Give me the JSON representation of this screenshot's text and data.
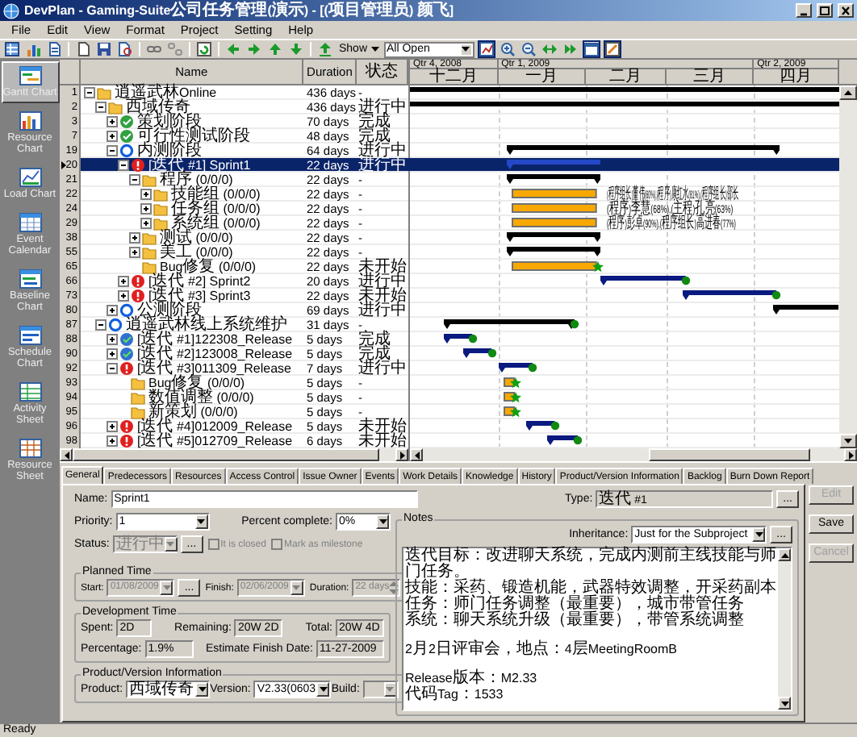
{
  "window": {
    "title": "DevPlan - Gaming-Suite公司任务管理(演示) - [(项目管理员) 颜飞]"
  },
  "menu": [
    "File",
    "Edit",
    "View",
    "Format",
    "Project",
    "Setting",
    "Help"
  ],
  "toolbar": {
    "show": "Show",
    "filter": "All Open",
    "toggles": [
      {
        "on": true
      },
      {
        "on": true
      },
      {
        "on": true
      }
    ]
  },
  "sidebar": {
    "items": [
      {
        "label": "Gantt Chart",
        "selected": true
      },
      {
        "label": "Resource Chart",
        "selected": false
      },
      {
        "label": "Load Chart",
        "selected": false
      },
      {
        "label": "Event Calendar",
        "selected": false
      },
      {
        "label": "Baseline Chart",
        "selected": false
      },
      {
        "label": "Schedule Chart",
        "selected": false
      },
      {
        "label": "Activity Sheet",
        "selected": false
      },
      {
        "label": "Resource Sheet",
        "selected": false
      }
    ]
  },
  "task_table": {
    "columns": [
      "Name",
      "Duration",
      "状态"
    ],
    "rows": [
      {
        "id": "1",
        "name": "逍遥武林Online",
        "duration": "436 days",
        "status": "-",
        "kind": "folder",
        "expanded": true,
        "selected": false,
        "bar": {
          "kind": "summary"
        },
        "children": [
          {
            "id": "2",
            "name": "西域传奇",
            "duration": "436 days",
            "status": "进行中",
            "kind": "folder",
            "expanded": true,
            "selected": false,
            "bar": {
              "kind": "summary"
            },
            "children": [
              {
                "id": "3",
                "name": "策划阶段",
                "duration": "70 days",
                "status": "完成",
                "kind": "done-stage",
                "expanded": false,
                "selected": false
              },
              {
                "id": "7",
                "name": "可行性测试阶段",
                "duration": "48 days",
                "status": "完成",
                "kind": "done-stage",
                "expanded": false,
                "selected": false
              },
              {
                "id": "19",
                "name": "内测阶段",
                "duration": "64 days",
                "status": "进行中",
                "kind": "active-stage",
                "expanded": true,
                "selected": false,
                "bar": {
                  "kind": "summary"
                },
                "children": [
                  {
                    "id": "20",
                    "name": "[迭代 #1] Sprint1",
                    "duration": "22 days",
                    "status": "进行中",
                    "kind": "iteration-late",
                    "expanded": true,
                    "selected": true,
                    "bar": {
                      "kind": "iteration"
                    },
                    "children": [
                      {
                        "id": "21",
                        "name": "程序 (0/0/0)",
                        "duration": "22 days",
                        "status": "-",
                        "kind": "folder",
                        "expanded": true,
                        "selected": false,
                        "bar": {
                          "kind": "summary"
                        },
                        "children": [
                          {
                            "id": "22",
                            "name": "技能组 (0/0/0)",
                            "duration": "22 days",
                            "status": "-",
                            "kind": "folder",
                            "expanded": false,
                            "selected": false,
                            "bar": {
                              "kind": "task",
                              "label": "(程序组长)董伟(60%),(程序)康红水(81%),(程序组长)邵长"
                            }
                          },
                          {
                            "id": "24",
                            "name": "任务组 (0/0/0)",
                            "duration": "22 days",
                            "status": "-",
                            "kind": "folder",
                            "expanded": false,
                            "selected": false,
                            "bar": {
                              "kind": "task",
                              "label": "(程序)李慧(68%),(主程)孔亮(63%)"
                            }
                          },
                          {
                            "id": "29",
                            "name": "系统组 (0/0/0)",
                            "duration": "22 days",
                            "status": "-",
                            "kind": "folder",
                            "expanded": false,
                            "selected": false,
                            "bar": {
                              "kind": "task",
                              "label": "(程序)彭卓(90%),(程序组长)高进春(77%)"
                            }
                          }
                        ]
                      },
                      {
                        "id": "38",
                        "name": "测试 (0/0/0)",
                        "duration": "22 days",
                        "status": "-",
                        "kind": "folder",
                        "expanded": false,
                        "selected": false,
                        "bar": {
                          "kind": "summary"
                        }
                      },
                      {
                        "id": "55",
                        "name": "美工 (0/0/0)",
                        "duration": "22 days",
                        "status": "-",
                        "kind": "folder",
                        "expanded": false,
                        "selected": false,
                        "bar": {
                          "kind": "summary"
                        }
                      },
                      {
                        "id": "65",
                        "name": "Bug修复 (0/0/0)",
                        "duration": "22 days",
                        "status": "未开始",
                        "kind": "folder",
                        "selected": false,
                        "bar": {
                          "kind": "task",
                          "star": true
                        }
                      }
                    ]
                  },
                  {
                    "id": "66",
                    "name": "[迭代 #2] Sprint2",
                    "duration": "20 days",
                    "status": "进行中",
                    "kind": "iteration-late",
                    "expanded": false,
                    "selected": false,
                    "bar": {
                      "kind": "iteration",
                      "dot": true
                    }
                  },
                  {
                    "id": "73",
                    "name": "[迭代 #3] Sprint3",
                    "duration": "22 days",
                    "status": "未开始",
                    "kind": "iteration-late",
                    "expanded": false,
                    "selected": false,
                    "bar": {
                      "kind": "iteration",
                      "dot": true
                    }
                  }
                ]
              },
              {
                "id": "80",
                "name": "公测阶段",
                "duration": "69 days",
                "status": "进行中",
                "kind": "active-stage",
                "expanded": false,
                "selected": false,
                "bar": {
                  "kind": "summary"
                }
              }
            ]
          },
          {
            "id": "87",
            "name": "逍遥武林线上系统维护",
            "duration": "31 days",
            "status": "-",
            "kind": "active-stage",
            "expanded": true,
            "selected": false,
            "bar": {
              "kind": "summary",
              "dot": true
            },
            "children": [
              {
                "id": "88",
                "name": "[迭代 #1]122308_Release",
                "duration": "5 days",
                "status": "完成",
                "kind": "iteration-done",
                "expanded": false,
                "selected": false,
                "bar": {
                  "kind": "iteration",
                  "dot": true
                }
              },
              {
                "id": "90",
                "name": "[迭代 #2]123008_Release",
                "duration": "5 days",
                "status": "完成",
                "kind": "iteration-done",
                "expanded": false,
                "selected": false,
                "bar": {
                  "kind": "iteration",
                  "dot": true
                }
              },
              {
                "id": "92",
                "name": "[迭代 #3]011309_Release",
                "duration": "7 days",
                "status": "进行中",
                "kind": "iteration-late",
                "expanded": true,
                "selected": false,
                "bar": {
                  "kind": "iteration",
                  "dot": true
                },
                "children": [
                  {
                    "id": "93",
                    "name": "Bug修复 (0/0/0)",
                    "duration": "5 days",
                    "status": "-",
                    "kind": "folder",
                    "selected": false,
                    "bar": {
                      "kind": "task",
                      "star": true
                    }
                  },
                  {
                    "id": "94",
                    "name": "数值调整 (0/0/0)",
                    "duration": "5 days",
                    "status": "-",
                    "kind": "folder",
                    "selected": false,
                    "bar": {
                      "kind": "task",
                      "star": true
                    }
                  },
                  {
                    "id": "95",
                    "name": "新策划 (0/0/0)",
                    "duration": "5 days",
                    "status": "-",
                    "kind": "folder",
                    "selected": false,
                    "bar": {
                      "kind": "task",
                      "star": true
                    }
                  }
                ]
              },
              {
                "id": "96",
                "name": "[迭代 #4]012009_Release",
                "duration": "5 days",
                "status": "未开始",
                "kind": "iteration-late",
                "expanded": false,
                "selected": false,
                "bar": {
                  "kind": "iteration",
                  "dot": true
                }
              },
              {
                "id": "98",
                "name": "[迭代 #5]012709_Release",
                "duration": "6 days",
                "status": "未开始",
                "kind": "iteration-late",
                "expanded": false,
                "selected": false,
                "bar": {
                  "kind": "iteration",
                  "dot": true
                }
              }
            ]
          }
        ]
      }
    ]
  },
  "gantt": {
    "quarters": [
      "Qtr 4, 2008",
      "Qtr 1, 2009",
      "Qtr 2, 2009"
    ],
    "months": [
      "十二月",
      "一月",
      "二月",
      "三月",
      "四月"
    ]
  },
  "details": {
    "tabs": [
      {
        "label": "General",
        "selected": true
      },
      {
        "label": "Predecessors",
        "selected": false
      },
      {
        "label": "Resources",
        "selected": false
      },
      {
        "label": "Access Control",
        "selected": false
      },
      {
        "label": "Issue Owner",
        "selected": false
      },
      {
        "label": "Events",
        "selected": false
      },
      {
        "label": "Work Details",
        "selected": false
      },
      {
        "label": "Knowledge",
        "selected": false
      },
      {
        "label": "History",
        "selected": false
      },
      {
        "label": "Product/Version Information",
        "selected": false
      },
      {
        "label": "Backlog",
        "selected": false
      },
      {
        "label": "Burn Down Report",
        "selected": false
      }
    ],
    "name": {
      "label": "Name:",
      "value": "Sprint1",
      "kind": "text"
    },
    "type": {
      "label": "Type:",
      "value": "迭代 #1",
      "kind": "text",
      "readonly": true,
      "button": "..."
    },
    "priority": {
      "label": "Priority:",
      "value": "1",
      "kind": "dropdown"
    },
    "percent_complete": {
      "label": "Percent complete:",
      "value": "0%",
      "kind": "dropdown"
    },
    "status": {
      "label": "Status:",
      "value": "进行中",
      "kind": "dropdown",
      "disabled": true,
      "button": "..."
    },
    "checkboxes": [
      {
        "label": "It is closed",
        "checked": false,
        "disabled": true
      },
      {
        "label": "Mark as milestone",
        "checked": false,
        "disabled": true
      }
    ],
    "planned_time": {
      "title": "Planned Time",
      "fields": [
        {
          "label": "Start:",
          "value": "01/08/2009",
          "kind": "dropdown",
          "disabled": true,
          "button": "..."
        },
        {
          "label": "Finish:",
          "value": "02/06/2009",
          "kind": "dropdown",
          "disabled": true
        },
        {
          "label": "Duration:",
          "value": "22 days",
          "kind": "spin",
          "disabled": true
        }
      ]
    },
    "development_time": {
      "title": "Development Time",
      "fields": [
        {
          "label": "Spent:",
          "value": "2D",
          "kind": "text",
          "readonly": true
        },
        {
          "label": "Remaining:",
          "value": "20W 2D",
          "kind": "text",
          "readonly": true
        },
        {
          "label": "Total:",
          "value": "20W 4D",
          "kind": "text",
          "readonly": true
        },
        {
          "label": "Percentage:",
          "value": "1.9%",
          "kind": "text",
          "readonly": true
        },
        {
          "label": "Estimate Finish Date:",
          "value": "11-27-2009",
          "kind": "text",
          "readonly": true
        }
      ]
    },
    "product_version": {
      "title": "Product/Version Information",
      "fields": [
        {
          "label": "Product:",
          "value": "西域传奇",
          "kind": "dropdown"
        },
        {
          "label": "Version:",
          "value": "V2.33(0603",
          "kind": "dropdown"
        },
        {
          "label": "Build:",
          "kind": "dropdown",
          "disabled": true
        }
      ]
    },
    "notes": {
      "title": "Notes",
      "inheritance": {
        "label": "Inheritance:",
        "value": "Just for the Subproject",
        "kind": "dropdown",
        "button": "..."
      },
      "paragraphs": [
        [
          "迭代目标：改进聊天系统，完成内测前主线技能与师门任务。",
          "技能：采药、锻造机能，武器特效调整，开采药副本",
          "任务：师门任务调整（最重要），城市带管任务",
          "系统：聊天系统升级（最重要），带管系统调整"
        ],
        [
          "2月2日评审会，地点：4层MeetingRoomB"
        ],
        [
          "Release版本：M2.33",
          "代码Tag：1533"
        ]
      ]
    }
  },
  "actions": [
    {
      "label": "Edit",
      "disabled": true
    },
    {
      "label": "Save",
      "disabled": false
    },
    {
      "label": "Cancel",
      "disabled": true
    }
  ],
  "status_bar": "Ready"
}
